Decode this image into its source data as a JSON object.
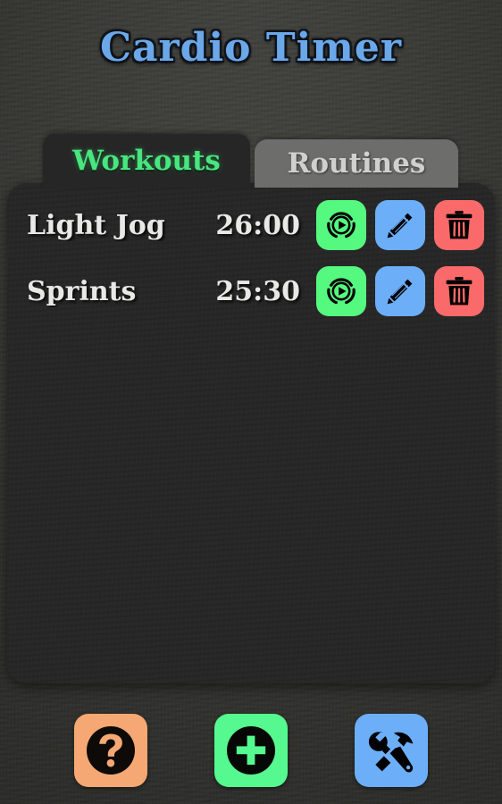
{
  "app": {
    "title": "Cardio Timer",
    "title_color": "#6aa8ea"
  },
  "tabs": [
    {
      "label": "Workouts",
      "active": true,
      "text_color": "#49e57f",
      "bg_color": "#262626"
    },
    {
      "label": "Routines",
      "active": false,
      "text_color": "#d0d0cf",
      "bg_color": "#6d6d6b"
    }
  ],
  "list": {
    "panel_color": "#262626",
    "rows": [
      {
        "name": "Light Jog",
        "time": "26:00",
        "actions": [
          {
            "name": "start",
            "icon": "play-circle-icon",
            "color": "#55f97f"
          },
          {
            "name": "edit",
            "icon": "pencil-icon",
            "color": "#6daef8"
          },
          {
            "name": "delete",
            "icon": "trash-icon",
            "color": "#fa6a6a"
          }
        ]
      },
      {
        "name": "Sprints",
        "time": "25:30",
        "actions": [
          {
            "name": "start",
            "icon": "play-circle-icon",
            "color": "#55f97f"
          },
          {
            "name": "edit",
            "icon": "pencil-icon",
            "color": "#6daef8"
          },
          {
            "name": "delete",
            "icon": "trash-icon",
            "color": "#fa6a6a"
          }
        ]
      }
    ]
  },
  "bottom_bar": {
    "buttons": [
      {
        "name": "help",
        "icon": "question-mark-icon",
        "color": "#f5a873"
      },
      {
        "name": "add",
        "icon": "plus-circle-icon",
        "color": "#55f98f"
      },
      {
        "name": "settings",
        "icon": "tools-icon",
        "color": "#6daef8"
      }
    ]
  }
}
